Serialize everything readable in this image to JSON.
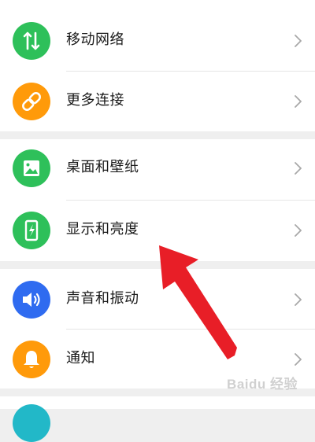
{
  "settings": {
    "rows": [
      {
        "label": "移动网络",
        "icon": "mobile-network-icon",
        "color": "#2ec05a"
      },
      {
        "label": "更多连接",
        "icon": "link-icon",
        "color": "#ff9a0a"
      },
      {
        "label": "桌面和壁纸",
        "icon": "wallpaper-image-icon",
        "color": "#2ec05a"
      },
      {
        "label": "显示和亮度",
        "icon": "display-brightness-icon",
        "color": "#2ec05a"
      },
      {
        "label": "声音和振动",
        "icon": "speaker-icon",
        "color": "#2f6bf0"
      },
      {
        "label": "通知",
        "icon": "bell-icon",
        "color": "#ff9a0a"
      }
    ]
  },
  "annotation": {
    "color": "#e81e27",
    "target": "显示和亮度"
  },
  "watermark": "Baidu 经验"
}
